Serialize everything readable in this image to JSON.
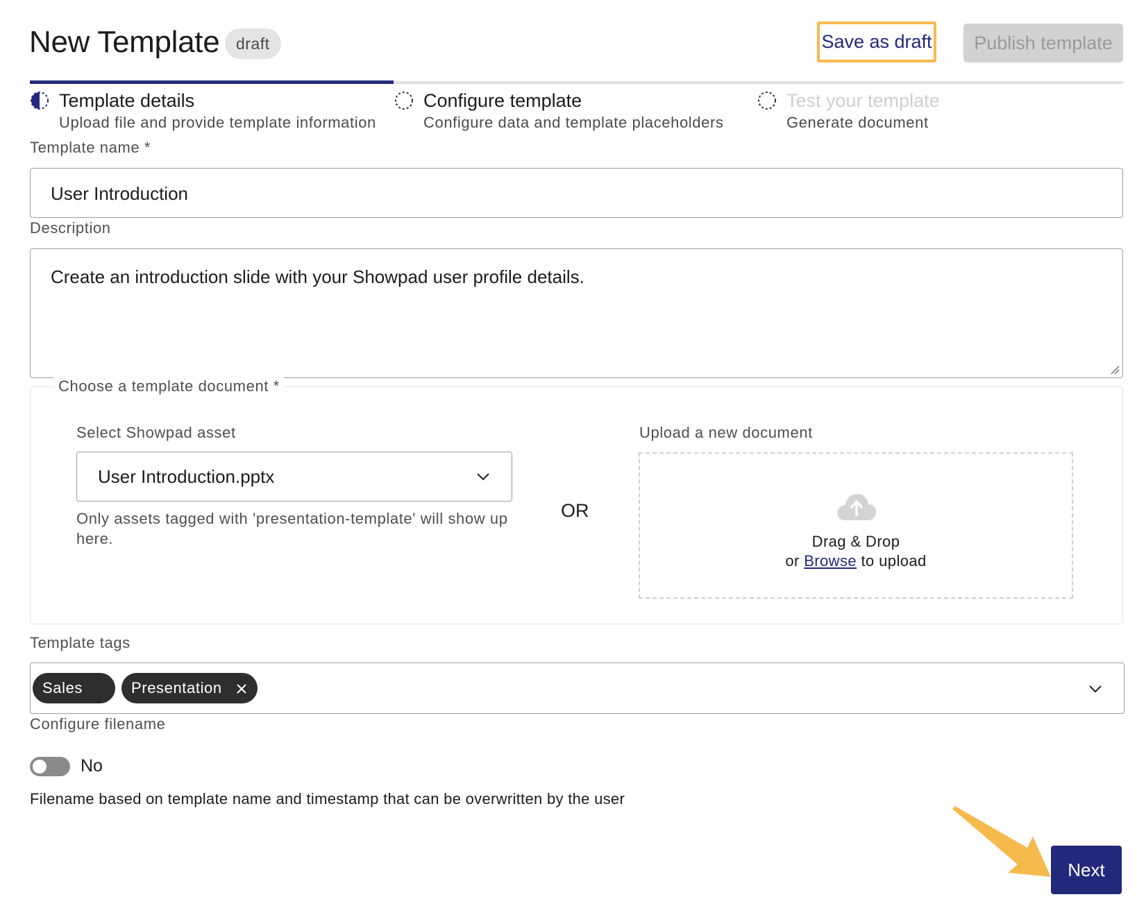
{
  "header": {
    "title": "New Template",
    "status_badge": "draft",
    "save_draft_label": "Save as draft",
    "publish_label": "Publish template"
  },
  "stepper": {
    "progress_fraction": 0.333,
    "steps": [
      {
        "title": "Template details",
        "subtitle": "Upload file and provide template information",
        "state": "current"
      },
      {
        "title": "Configure template",
        "subtitle": "Configure data and template placeholders",
        "state": "pending"
      },
      {
        "title": "Test your template",
        "subtitle": "Generate document",
        "state": "disabled"
      }
    ]
  },
  "form": {
    "template_name": {
      "label": "Template name *",
      "value": "User Introduction"
    },
    "description": {
      "label": "Description",
      "value": "Create an introduction slide with your Showpad user profile details."
    },
    "document": {
      "legend": "Choose a template document *",
      "select_label": "Select Showpad asset",
      "select_value": "User Introduction.pptx",
      "select_helper": "Only assets tagged with 'presentation-template' will show up here.",
      "or_text": "OR",
      "upload_label": "Upload a new document",
      "dropzone_line1": "Drag & Drop",
      "dropzone_prefix": "or",
      "dropzone_link": "Browse",
      "dropzone_suffix": "to upload"
    },
    "tags": {
      "label": "Template tags",
      "items": [
        "Sales",
        "Presentation"
      ]
    },
    "filename": {
      "label": "Configure filename",
      "toggle_value": "No",
      "toggle_on": false,
      "description": "Filename based on template name and timestamp that can be overwritten by the user"
    }
  },
  "footer": {
    "next_label": "Next"
  },
  "colors": {
    "accent": "#23297a",
    "highlight": "#f6b94d",
    "chip": "#2e2e2e"
  },
  "icons": {
    "step1": "half-filled-circle-icon",
    "step2": "dashed-circle-icon",
    "step3": "dashed-circle-icon",
    "select": "chevron-down-icon",
    "upload": "cloud-upload-icon",
    "tag_remove": "close-icon",
    "pointer": "arrow-pointer-icon"
  }
}
